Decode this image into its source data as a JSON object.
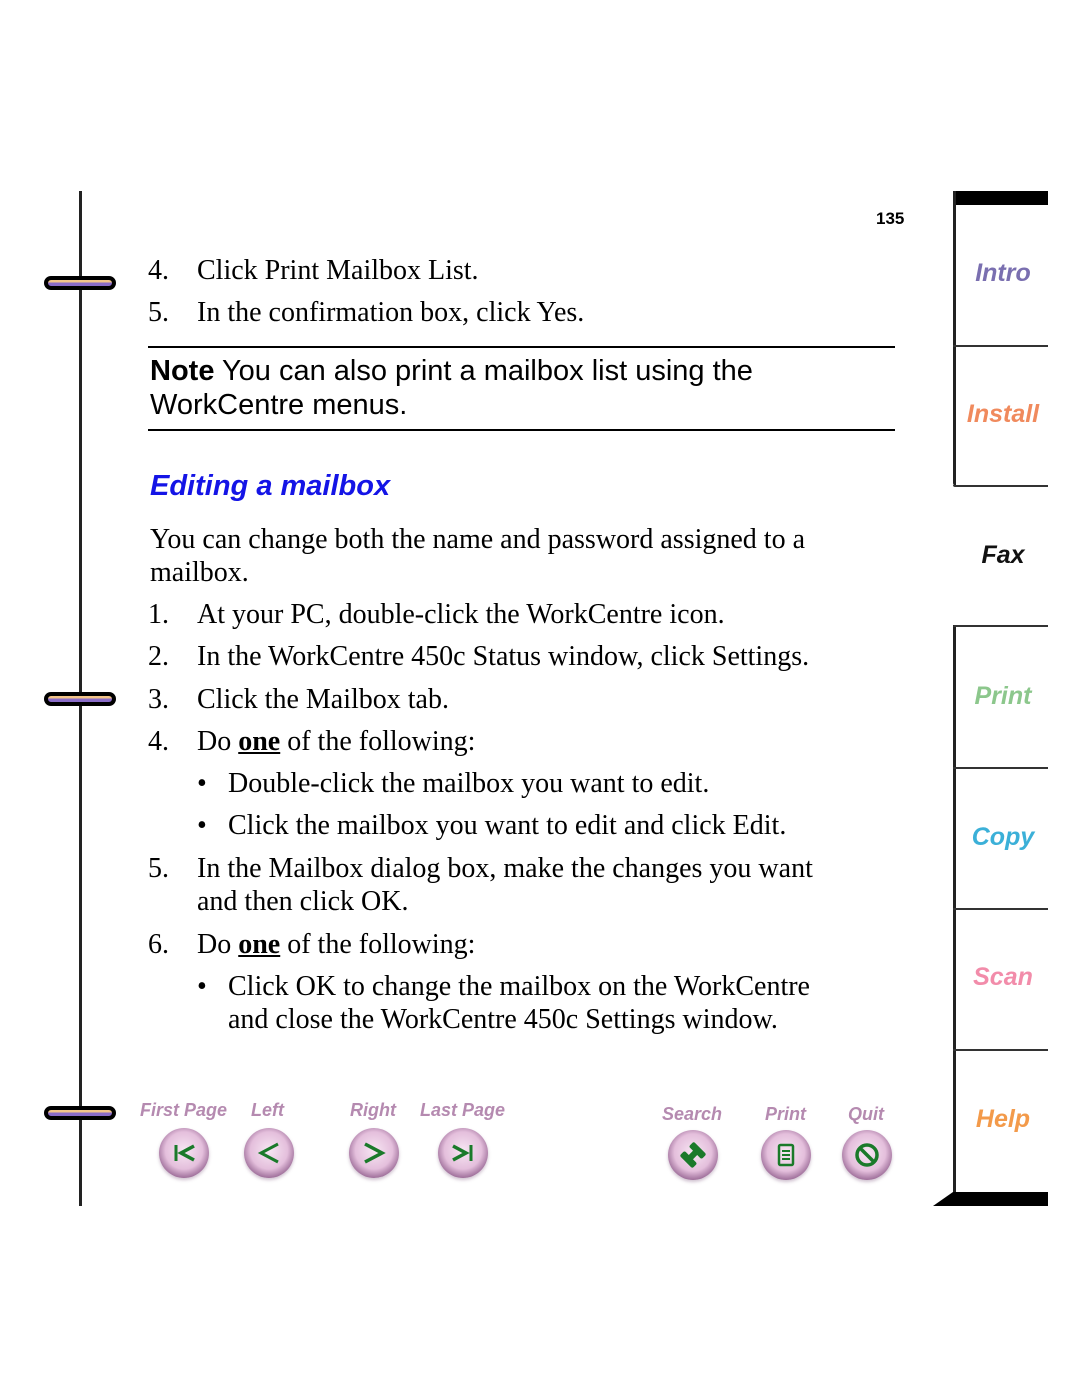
{
  "page_number": "135",
  "steps_top": [
    {
      "num": "4.",
      "text": "Click Print Mailbox List."
    },
    {
      "num": "5.",
      "text": "In the confirmation box, click Yes."
    }
  ],
  "note": {
    "label": "Note",
    "text": " You can also print a mailbox list using the WorkCentre menus."
  },
  "section": {
    "heading": "Editing a mailbox",
    "intro_line1": "You can change both the name and password assigned to a",
    "intro_line2": "mailbox.",
    "steps": [
      {
        "num": "1.",
        "text": "At your PC, double-click the WorkCentre icon."
      },
      {
        "num": "2.",
        "text": "In the WorkCentre 450c Status window, click Settings."
      },
      {
        "num": "3.",
        "text": "Click the Mailbox tab."
      },
      {
        "num": "4.",
        "pre": "Do ",
        "emph": "one",
        "post": " of the following:"
      },
      {
        "num": "5.",
        "line1": "In the Mailbox dialog box, make the changes you want",
        "line2": "and then click OK."
      },
      {
        "num": "6.",
        "pre": "Do ",
        "emph": "one",
        "post": " of the following:"
      }
    ],
    "bullets_step4": [
      "Double-click the mailbox you want to edit.",
      "Click the mailbox you want to edit and click Edit."
    ],
    "bullets_step6": {
      "line1": "Click OK to change the mailbox on the WorkCentre",
      "line2": "and close the WorkCentre 450c Settings window."
    },
    "bullet_glyph": "•"
  },
  "tabs": [
    {
      "label": "Intro",
      "color": "#7a6fb0",
      "active": false
    },
    {
      "label": "Install",
      "color": "#f08a5d",
      "active": false
    },
    {
      "label": "Fax",
      "color": "#111111",
      "active": true
    },
    {
      "label": "Print",
      "color": "#8cc78c",
      "active": false
    },
    {
      "label": "Copy",
      "color": "#3bb0d8",
      "active": false
    },
    {
      "label": "Scan",
      "color": "#f28caa",
      "active": false
    },
    {
      "label": "Help",
      "color": "#f39a4a",
      "active": false
    }
  ],
  "nav": {
    "first_page": "First Page",
    "left": "Left",
    "right": "Right",
    "last_page": "Last Page",
    "search": "Search",
    "print": "Print",
    "quit": "Quit",
    "icon_color": "#1a7a2a",
    "label_color": "#b58ab0"
  }
}
